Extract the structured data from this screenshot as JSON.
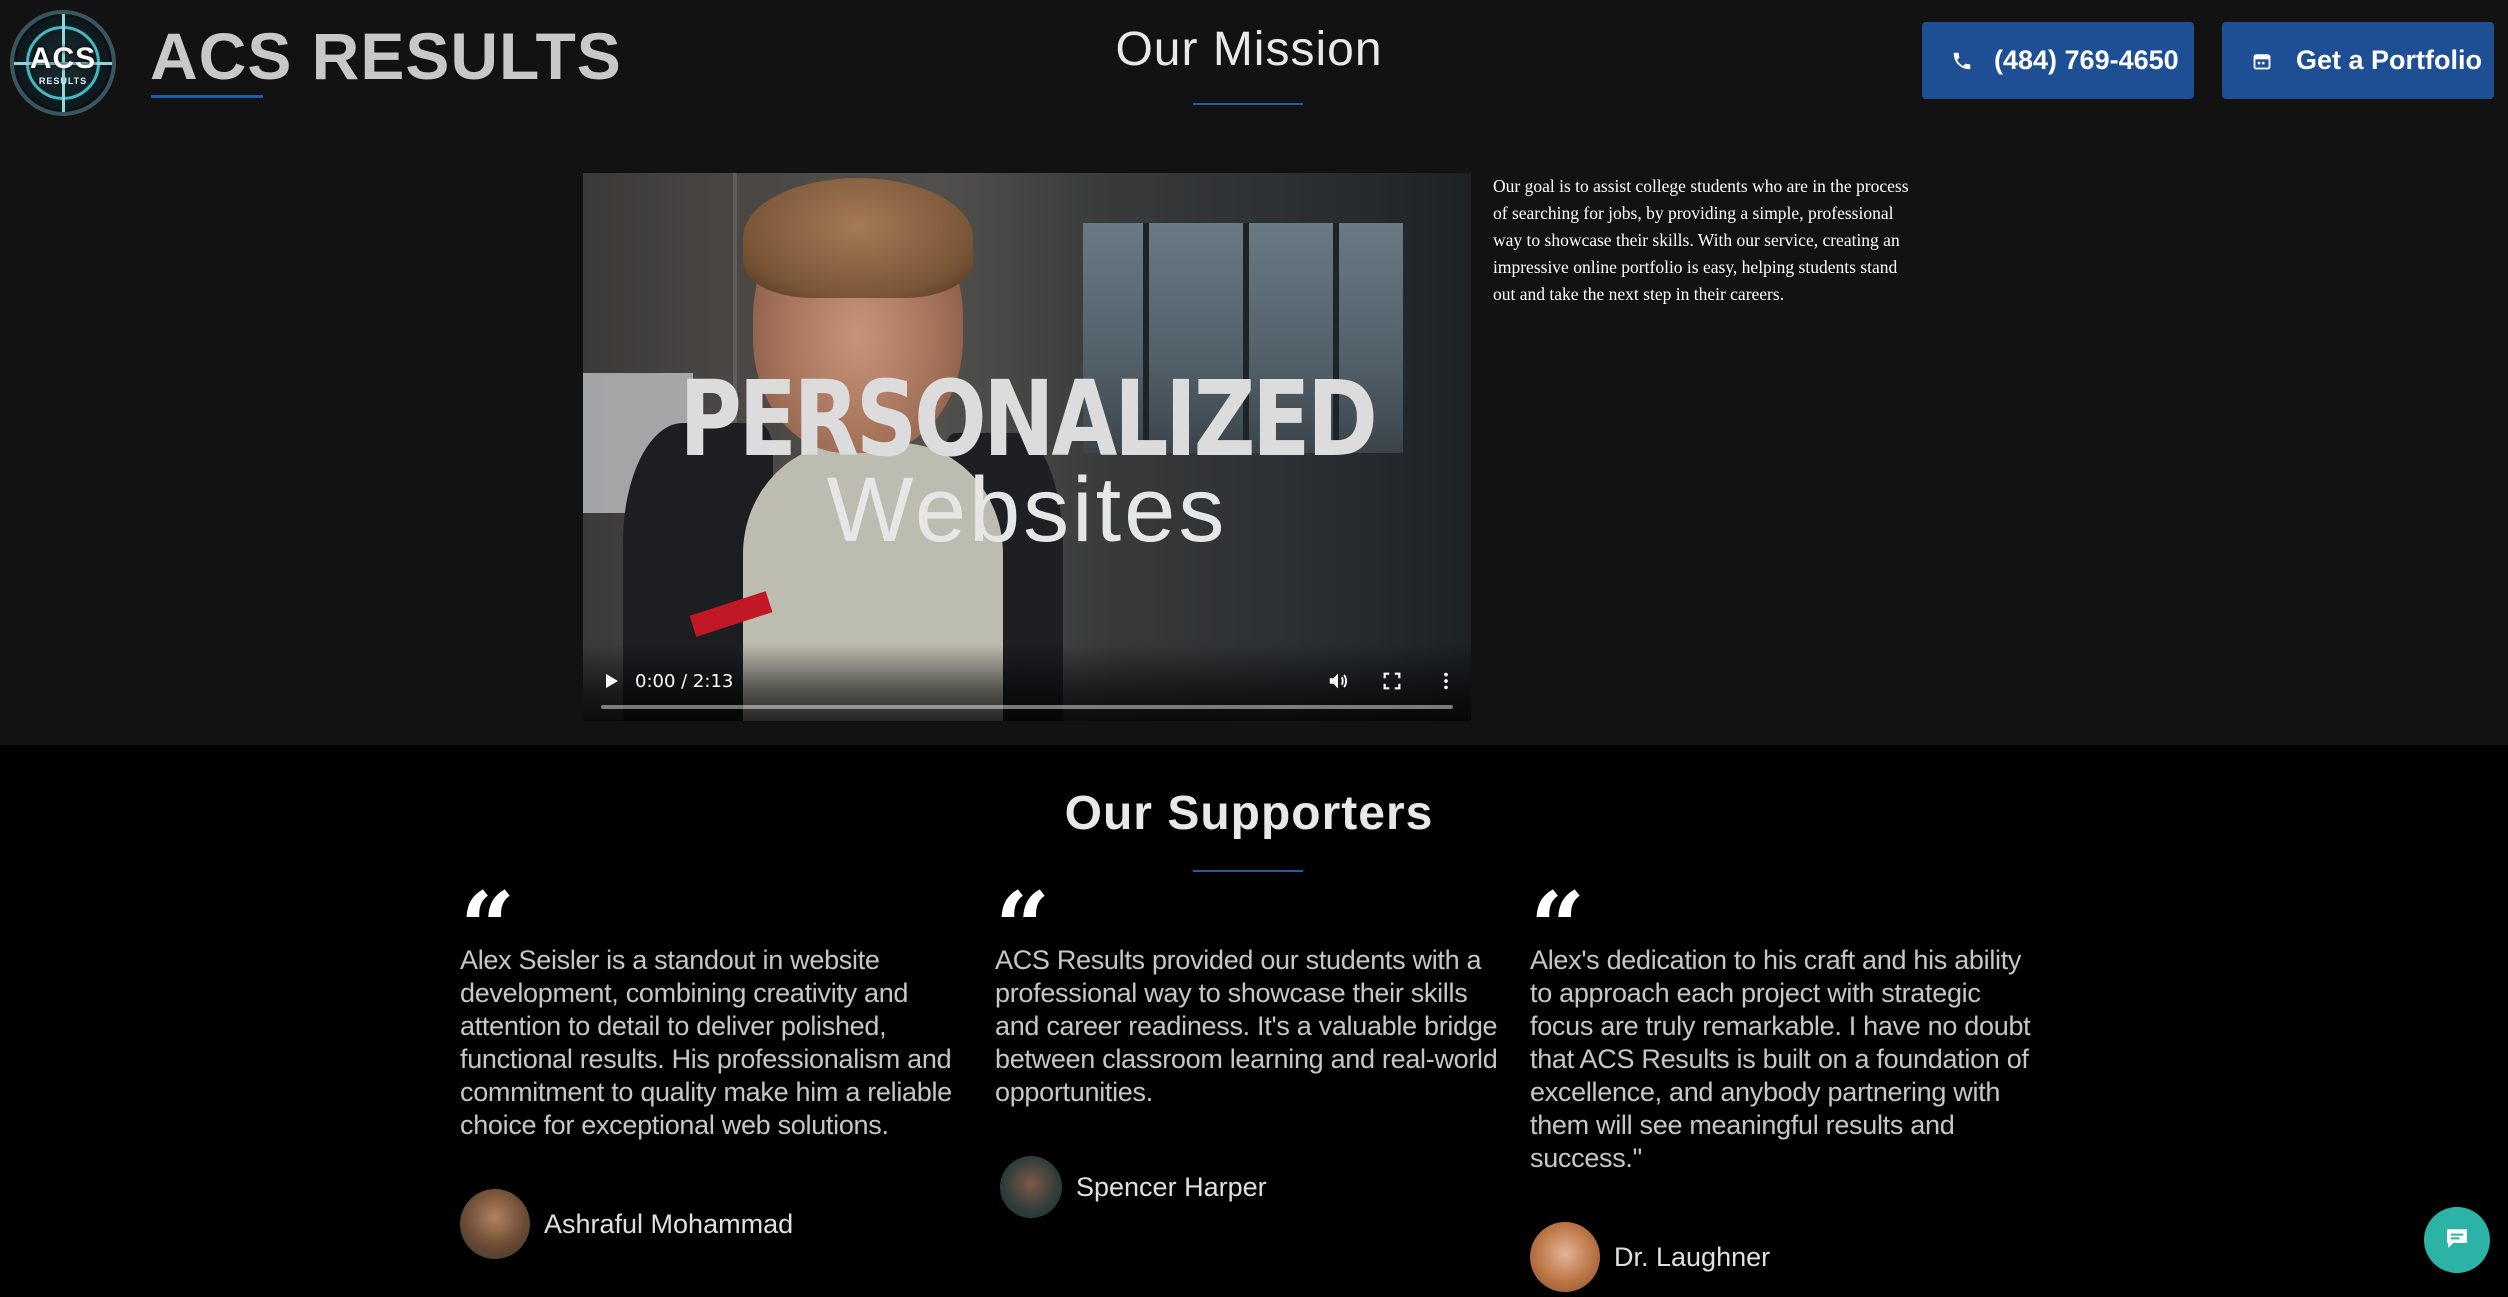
{
  "header": {
    "logo_text": "ACS",
    "logo_subtext": "RESULTS",
    "brand_title": "ACS RESULTS",
    "phone_button_label": "(484) 769-4650",
    "portfolio_button_label": "Get a Portfolio"
  },
  "mission": {
    "title": "Our Mission",
    "description": "Our goal is to assist college students who are in the process of searching for jobs, by providing a simple, professional way to showcase their skills. With our service, creating an impressive online portfolio is easy, helping students stand out and take the next step in their careers.",
    "video": {
      "overlay_line1": "PERSONALIZED",
      "overlay_line2": "Websites",
      "time_display": "0:00 / 2:13",
      "progress": 0
    }
  },
  "supporters": {
    "title": "Our Supporters",
    "quote_mark": "“",
    "items": [
      {
        "quote": "Alex Seisler is a standout in website development, combining creativity and attention to detail to deliver polished, functional results. His professionalism and commitment to quality make him a reliable choice for exceptional web solutions.",
        "name": "Ashraful Mohammad"
      },
      {
        "quote": "ACS Results provided our students with a professional way to showcase their skills and career readiness. It's a valuable bridge between classroom learning and real-world opportunities.",
        "name": "Spencer Harper"
      },
      {
        "quote": "Alex's dedication to his craft and his ability to approach each project with strategic focus are truly remarkable. I have no doubt that ACS Results is built on a foundation of excellence, and anybody partnering with them will see meaningful results and success.\"",
        "name": "Dr. Laughner"
      }
    ]
  },
  "colors": {
    "accent_blue": "#1e4f94",
    "underline_blue": "#1f5dab",
    "chat_teal": "#2bb3a5"
  },
  "icons": {
    "phone": "phone-icon",
    "portfolio": "calendar-icon",
    "chat": "chat-icon"
  }
}
